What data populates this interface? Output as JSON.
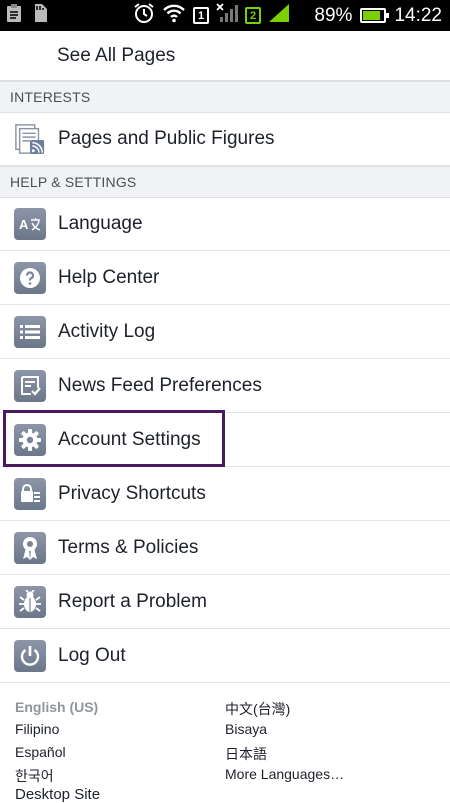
{
  "status_bar": {
    "sim1": "1",
    "sim2": "2",
    "battery_percent": "89%",
    "time": "14:22"
  },
  "see_all_pages": "See All Pages",
  "sections": {
    "interests": "INTERESTS",
    "help_settings": "HELP & SETTINGS"
  },
  "items": {
    "pages_public_figures": "Pages and Public Figures",
    "language": "Language",
    "help_center": "Help Center",
    "activity_log": "Activity Log",
    "news_feed_preferences": "News Feed Preferences",
    "account_settings": "Account Settings",
    "privacy_shortcuts": "Privacy Shortcuts",
    "terms_policies": "Terms & Policies",
    "report_problem": "Report a Problem",
    "log_out": "Log Out"
  },
  "languages": {
    "current": "English (US)",
    "filipino": "Filipino",
    "espanol": "Español",
    "korean": "한국어",
    "chinese_tw": "中文(台灣)",
    "bisaya": "Bisaya",
    "japanese": "日本語",
    "more": "More Languages…"
  },
  "desktop_site": "Desktop Site",
  "colors": {
    "highlight_border": "#4a1a5e",
    "icon_tile": "#7a8397",
    "section_bg": "#f1f2f4"
  }
}
